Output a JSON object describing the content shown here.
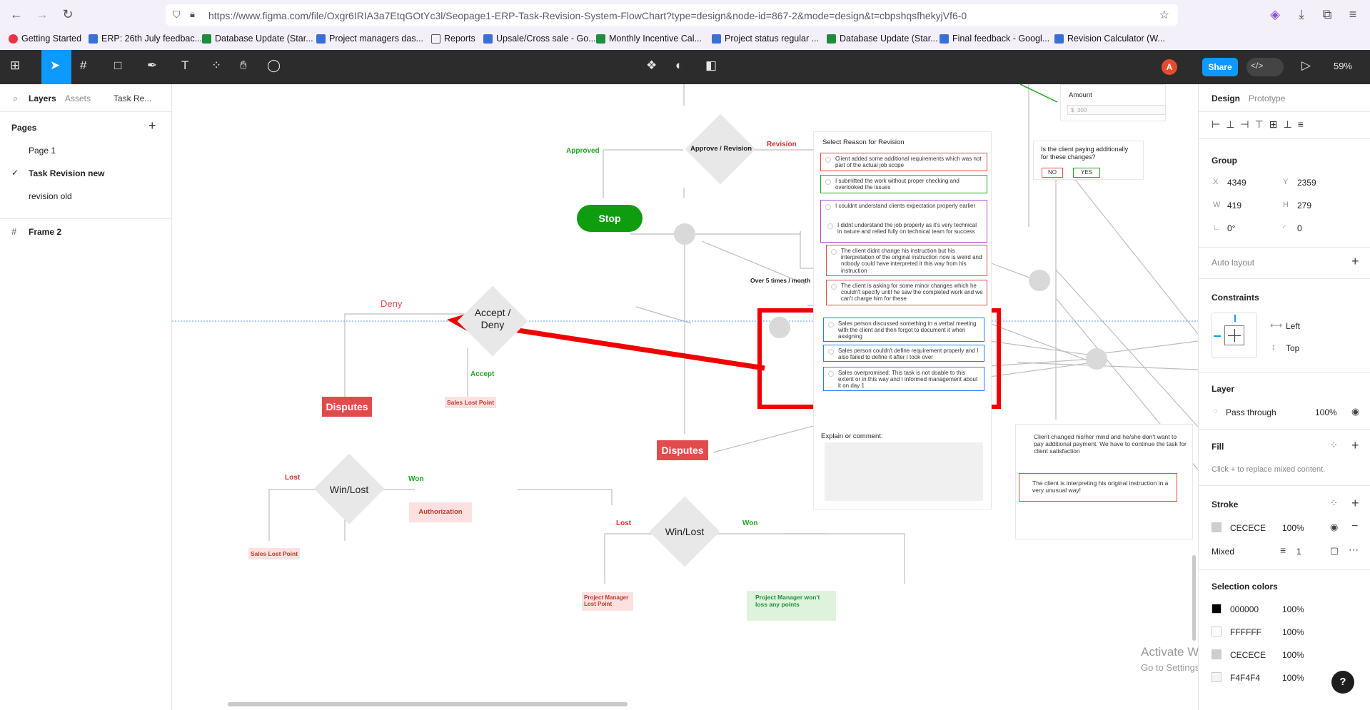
{
  "browser": {
    "url": "https://www.figma.com/file/Oxgr6IRIA3a7EtqGOtYc3l/Seopage1-ERP-Task-Revision-System-FlowChart?type=design&node-id=867-2&mode=design&t=cbpshqsfhekyjVf6-0",
    "bookmarks": [
      "Getting Started",
      "ERP: 26th July feedbac...",
      "Database Update (Star...",
      "Project managers das...",
      "Reports",
      "Upsale/Cross sale - Go...",
      "Monthly Incentive Cal...",
      "Project status regular ...",
      "Database Update (Star...",
      "Final feedback - Googl...",
      "Revision Calculator (W..."
    ]
  },
  "toolbar": {
    "share_label": "Share",
    "zoom": "59%",
    "avatar": "A"
  },
  "left_panel": {
    "tabs": {
      "layers": "Layers",
      "assets": "Assets",
      "page": "Task Re..."
    },
    "pages_heading": "Pages",
    "pages": [
      "Page 1",
      "Task Revision new",
      "revision old"
    ],
    "frame": "Frame 2"
  },
  "canvas": {
    "approve_revision": "Approve / Revision",
    "approved": "Approved",
    "revision": "Revision",
    "stop": "Stop",
    "over_5": "Over 5 times / month",
    "accept_deny": "Accept / Deny",
    "deny": "Deny",
    "accept": "Accept",
    "sales_lost_point": "Sales Lost Point",
    "disputes": "Disputes",
    "win_lost": "Win/Lost",
    "lost": "Lost",
    "won": "Won",
    "authorization": "Authorization",
    "pm_lost_point": "Project Manager Lost Point",
    "pm_no_loss": "Project Manager won't loss any points",
    "reason_title": "Select  Reason for Revision",
    "reasons": [
      "Client added some additional requirements which was not part of the actual job scope",
      "I submitted the work without proper checking and overlooked the issues",
      "I couldnt understand clients expectation properly earlier",
      "I didnt understand the job properly as it's very technical in nature and relied fully on technical team for success",
      "The client didnt change his instruction but his interpretation of the original instruction now is weird and nobody could have interpreted it this way from his instruction",
      "The client is asking for some minor changes which he couldn't specify until he saw the completed work and we can't charge him for these",
      "Sales person discussed something in a verbal meeting with the client and then forgot to document it when assigning",
      "Sales person couldn't define requirement properly and I also failed to define it after I took over",
      "Sales overpromised: This task is not doable to this extent or in this way and I informed management about it on day 1"
    ],
    "explain": "Explain or comment:",
    "amount_label": "Amount",
    "amount_value": "300",
    "currency": "$",
    "paying_q": "Is the client paying additionally for these changes?",
    "no": "NO",
    "yes": "YES",
    "client_changed": "Client changed his/her mind and he/she don't want to pay additional payment. We have to continue the task for client satisfaction",
    "client_interpreting": "The client is interpreting his original instruction in a very unusual way!",
    "watermark_title": "Activate Windows",
    "watermark_sub": "Go to Settings to activate Windows."
  },
  "right_panel": {
    "tabs": {
      "design": "Design",
      "prototype": "Prototype"
    },
    "group": "Group",
    "x": "4349",
    "y": "2359",
    "w": "419",
    "h": "279",
    "rotation": "0°",
    "radius": "0",
    "auto_layout": "Auto layout",
    "constraints": "Constraints",
    "c_left": "Left",
    "c_top": "Top",
    "layer": "Layer",
    "pass_through": "Pass through",
    "layer_opacity": "100%",
    "fill": "Fill",
    "fill_hint": "Click + to replace mixed content.",
    "stroke": "Stroke",
    "stroke_color": "CECECE",
    "stroke_opacity": "100%",
    "stroke_mixed": "Mixed",
    "stroke_width": "1",
    "selection_colors": "Selection colors",
    "colors": [
      {
        "hex": "000000",
        "opacity": "100%",
        "color": "#000000"
      },
      {
        "hex": "FFFFFF",
        "opacity": "100%",
        "color": "#FFFFFF"
      },
      {
        "hex": "CECECE",
        "opacity": "100%",
        "color": "#CECECE"
      },
      {
        "hex": "F4F4F4",
        "opacity": "100%",
        "color": "#F4F4F4"
      }
    ],
    "help": "?"
  }
}
